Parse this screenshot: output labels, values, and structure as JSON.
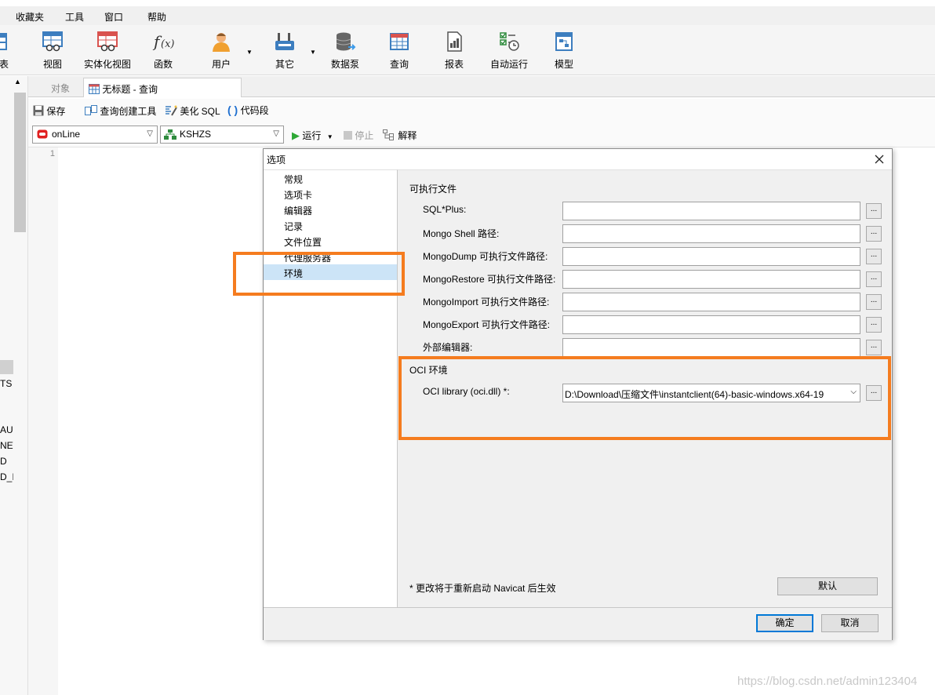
{
  "menubar": {
    "items": [
      "收藏夹",
      "工具",
      "窗口",
      "帮助"
    ]
  },
  "toolbar": {
    "partial_label": "表",
    "items": [
      {
        "label": "视图",
        "icon": "view-table-icon"
      },
      {
        "label": "实体化视图",
        "icon": "materialized-view-icon"
      },
      {
        "label": "函数",
        "icon": "function-icon"
      },
      {
        "label": "用户",
        "icon": "user-icon"
      },
      {
        "label": "其它",
        "icon": "tools-icon"
      },
      {
        "label": "数据泵",
        "icon": "database-pump-icon"
      },
      {
        "label": "查询",
        "icon": "query-icon"
      },
      {
        "label": "报表",
        "icon": "report-icon"
      },
      {
        "label": "自动运行",
        "icon": "schedule-icon"
      },
      {
        "label": "模型",
        "icon": "model-icon"
      }
    ]
  },
  "tabs": {
    "objects": "对象",
    "query": "无标题 - 查询"
  },
  "query_toolbar": {
    "save": "保存",
    "builder": "查询创建工具",
    "beautify": "美化 SQL",
    "snippet": "代码段",
    "connection": "onLine",
    "schema": "KSHZS",
    "run": "运行",
    "stop": "停止",
    "explain": "解释"
  },
  "editor": {
    "line1": "1"
  },
  "left_items": [
    "TS",
    "AUD",
    "NEW",
    "D",
    "D_I"
  ],
  "dialog": {
    "title": "选项",
    "nav": [
      "常规",
      "选项卡",
      "编辑器",
      "记录",
      "文件位置",
      "代理服务器",
      "环境"
    ],
    "section_exec": "可执行文件",
    "rows": [
      {
        "label": "SQL*Plus:",
        "value": ""
      },
      {
        "label": "Mongo Shell 路径:",
        "value": ""
      },
      {
        "label": "MongoDump 可执行文件路径:",
        "value": ""
      },
      {
        "label": "MongoRestore 可执行文件路径:",
        "value": ""
      },
      {
        "label": "MongoImport 可执行文件路径:",
        "value": ""
      },
      {
        "label": "MongoExport 可执行文件路径:",
        "value": ""
      },
      {
        "label": "外部编辑器:",
        "value": ""
      }
    ],
    "browse": "...",
    "section_oci": "OCI 环境",
    "oci_label": "OCI library (oci.dll) *:",
    "oci_value": "D:\\Download\\压缩文件\\instantclient(64)-basic-windows.x64-19",
    "note": "* 更改将于重新启动 Navicat 后生效",
    "default_btn": "默认",
    "ok_btn": "确定",
    "cancel_btn": "取消"
  },
  "watermark": "https://blog.csdn.net/admin123404",
  "colors": {
    "highlight": "#f57c1f",
    "selected_nav": "#cce4f7",
    "accent_ok": "#0078d7"
  }
}
